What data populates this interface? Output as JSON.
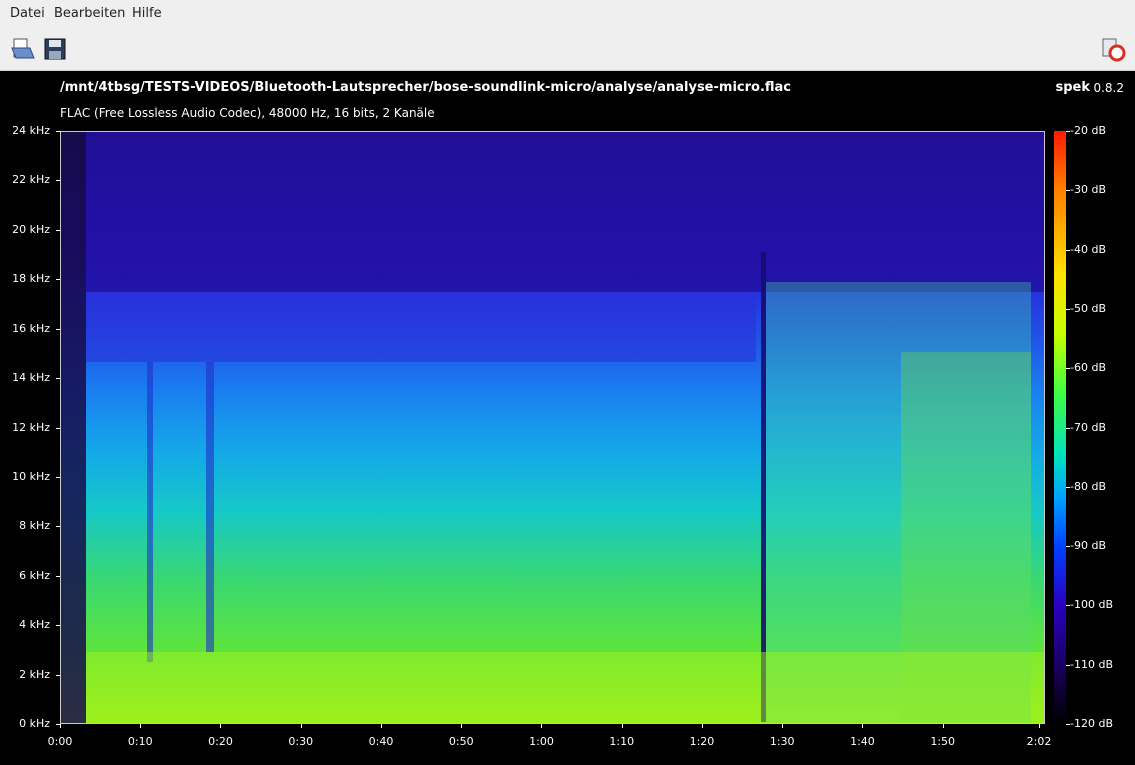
{
  "menu": [
    "Datei",
    "Bearbeiten",
    "Hilfe"
  ],
  "toolbar": {
    "open_icon": "open-file-icon",
    "save_icon": "save-icon",
    "help_icon": "help-lifebuoy-icon"
  },
  "header": {
    "file_path": "/mnt/4tbsg/TESTS-VIDEOS/Bluetooth-Lautsprecher/bose-soundlink-micro/analyse/analyse-micro.flac",
    "file_info": "FLAC (Free Lossless Audio Codec), 48000 Hz, 16 bits, 2 Kanäle",
    "app_name": "spek",
    "app_version": "0.8.2"
  },
  "spectrogram": {
    "y_ticks": [
      "24 kHz",
      "22 kHz",
      "20 kHz",
      "18 kHz",
      "16 kHz",
      "14 kHz",
      "12 kHz",
      "10 kHz",
      "8 kHz",
      "6 kHz",
      "4 kHz",
      "2 kHz",
      "0 kHz"
    ],
    "x_ticks": [
      "0:00",
      "0:10",
      "0:20",
      "0:30",
      "0:40",
      "0:50",
      "1:00",
      "1:10",
      "1:20",
      "1:30",
      "1:40",
      "1:50",
      "2:02"
    ],
    "db_ticks": [
      "-20 dB",
      "-30 dB",
      "-40 dB",
      "-50 dB",
      "-60 dB",
      "-70 dB",
      "-80 dB",
      "-90 dB",
      "-100 dB",
      "-110 dB",
      "-120 dB"
    ]
  }
}
